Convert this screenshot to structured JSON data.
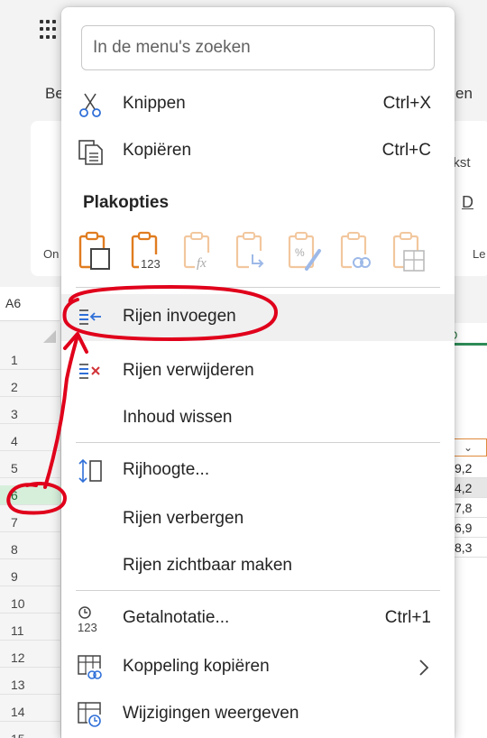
{
  "background": {
    "ribbon_tab_left": "Be",
    "ribbon_tab_right": "en",
    "ribbon_left_partial": "On",
    "ribbon_right_partial": "Le",
    "ribbon_text_partial": "ekst",
    "ribbon_underline_letter": "D",
    "name_box": "A6",
    "column_header_partial": "D",
    "row_numbers": [
      "1",
      "2",
      "3",
      "4",
      "5",
      "6",
      "7",
      "8",
      "9",
      "10",
      "11",
      "12",
      "13",
      "14",
      "15"
    ],
    "selected_row": "6",
    "cell_values": [
      "9,2",
      "4,2",
      "7,8",
      "6,9",
      "8,3"
    ],
    "filter_dropdown": "⌄"
  },
  "menu": {
    "search_placeholder": "In de menu's zoeken",
    "items": [
      {
        "label": "Knippen",
        "shortcut": "Ctrl+X",
        "icon": "scissors-icon"
      },
      {
        "label": "Kopiëren",
        "shortcut": "Ctrl+C",
        "icon": "copy-icon"
      }
    ],
    "paste_heading": "Plakopties",
    "paste_icons": [
      "paste-icon",
      "paste-values-icon",
      "paste-formulas-icon",
      "paste-transpose-icon",
      "paste-formatting-icon",
      "paste-link-icon",
      "paste-keep-width-icon"
    ],
    "paste_values_text": "123",
    "paste_formulas_text": "fx",
    "row_items": [
      {
        "label": "Rijen invoegen",
        "icon": "insert-rows-icon"
      },
      {
        "label": "Rijen verwijderen",
        "icon": "delete-rows-icon"
      },
      {
        "label": "Inhoud wissen",
        "icon": ""
      }
    ],
    "height_items": [
      {
        "label": "Rijhoogte...",
        "icon": "row-height-icon"
      },
      {
        "label": "Rijen verbergen",
        "icon": ""
      },
      {
        "label": "Rijen zichtbaar maken",
        "icon": ""
      }
    ],
    "format_items": [
      {
        "label": "Getalnotatie...",
        "shortcut": "Ctrl+1",
        "icon": "number-format-icon"
      },
      {
        "label": "Koppeling kopiëren",
        "icon": "copy-link-icon"
      },
      {
        "label": "Wijzigingen weergeven",
        "icon": "show-changes-icon"
      }
    ],
    "number_format_icon_text": "123"
  },
  "colors": {
    "accent_red": "#e0001b",
    "icon_blue": "#2f6fd8",
    "icon_orange": "#e07c20",
    "delete_red": "#d13438",
    "selected_row_bg": "#d6efdb"
  }
}
